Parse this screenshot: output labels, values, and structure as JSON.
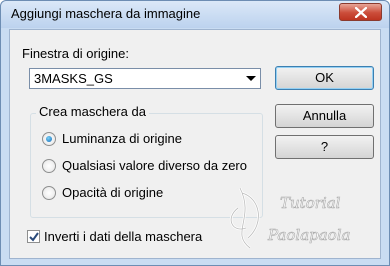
{
  "dialog": {
    "title": "Aggiungi maschera da immagine"
  },
  "source": {
    "label": "Finestra di origine:",
    "selected": "3MASKS_GS"
  },
  "buttons": {
    "ok": "OK",
    "cancel": "Annulla",
    "help": "?"
  },
  "group": {
    "title": "Crea maschera da",
    "options": [
      {
        "label": "Luminanza di origine",
        "checked": true
      },
      {
        "label": "Qualsiasi valore diverso da zero",
        "checked": false
      },
      {
        "label": "Opacità di origine",
        "checked": false
      }
    ]
  },
  "invert": {
    "label": "Inverti i dati della maschera",
    "checked": true
  },
  "watermark": {
    "line1": "Tutorial",
    "line2": "Paolapaola"
  },
  "colors": {
    "accent": "#136ab8",
    "close": "#c8402e"
  }
}
